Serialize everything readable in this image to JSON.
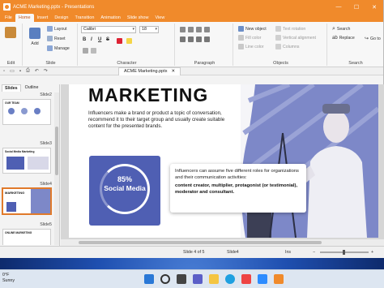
{
  "window": {
    "title": "ACME Marketing.pptx - Presentations",
    "controls": {
      "minimize": "—",
      "maximize": "☐",
      "close": "✕"
    }
  },
  "menu": {
    "tabs": [
      "File",
      "Home",
      "Insert",
      "Design",
      "Transition",
      "Animation",
      "Slide show",
      "View"
    ],
    "active": "Home"
  },
  "ribbon": {
    "edit": {
      "label": "Edit",
      "paste": "Paste"
    },
    "slide": {
      "label": "Slide",
      "add": "Add",
      "layout": "Layout",
      "reset": "Reset",
      "manage": "Manage"
    },
    "character": {
      "label": "Character",
      "font": "Calibri",
      "size": "18",
      "bold": "B",
      "italic": "I",
      "underline": "U",
      "strike": "S"
    },
    "paragraph": {
      "label": "Paragraph"
    },
    "objects": {
      "label": "Objects",
      "new_object": "New object",
      "fill_color": "Fill color",
      "line_color": "Line color",
      "text_rotation": "Text rotation",
      "vertical_alignment": "Vertical alignment",
      "columns": "Columns"
    },
    "search": {
      "label": "Search",
      "search": "Search",
      "replace": "Replace",
      "goto": "Go to"
    }
  },
  "quick_access": {
    "document_tab": "ACME Marketing.pptx",
    "close": "✕"
  },
  "slide_pane": {
    "tabs": [
      "Slides",
      "Outline"
    ],
    "labels": [
      "Slide2",
      "Slide3",
      "Slide4",
      "Slide5"
    ],
    "thumb_titles": [
      "OUR TEAM",
      "Social Media Marketing",
      "MARKETING",
      "ONLINE MARKETING"
    ]
  },
  "slide": {
    "headline": "MARKETING",
    "intro": "Influencers make a brand or product a topic of conversation, recommend it to their target group and usually create suitable content for the presented brands.",
    "stat_percent": "85%",
    "stat_label": "Social Media",
    "callout_text": "Influencers can assume five different roles for organizations and their communication activities:",
    "callout_roles": "content creator, multiplier, protagonist (or testimonial), moderator and consultant."
  },
  "statusbar": {
    "slide_position": "Slide 4 of 5",
    "slide_name": "Slide4",
    "mode": "Ins"
  },
  "taskbar": {
    "temperature": "0°F",
    "condition": "Sunny"
  }
}
